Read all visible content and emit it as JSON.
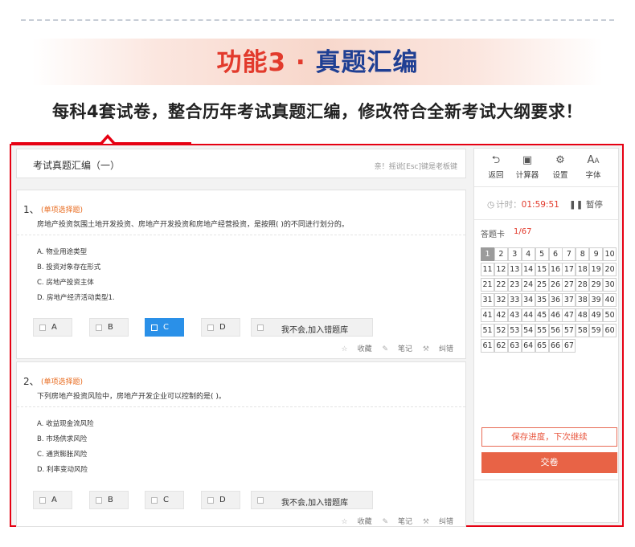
{
  "banner": {
    "title_accent": "功能3 · ",
    "title_main": "真题汇编",
    "subtitle": "每科4套试卷，整合历年考试真题汇编，修改符合全新考试大纲要求！"
  },
  "exam": {
    "title": "考试真题汇编（一）",
    "hint": "亲！摇说[Esc]键是老板键"
  },
  "questions": [
    {
      "number": "1、",
      "type": "(单项选择题)",
      "text": "房地产投资氛围土地开发投资、房地产开发投资和房地产经营投资，是按照( )的不同进行划分的。",
      "options": [
        "A. 物业用途类型",
        "B. 投资对象存在形式",
        "C. 房地产投资主体",
        "D. 房地产经济活动类型1."
      ],
      "answers": [
        "A",
        "B",
        "C",
        "D"
      ],
      "selected_answer": "C",
      "unsure_label": "我不会,加入错题库"
    },
    {
      "number": "2、",
      "type": "(单项选择题)",
      "text": "下列房地产投资风险中，房地产开发企业可以控制的是( )。",
      "options": [
        "A. 收益现金流风险",
        "B. 市场供求风险",
        "C. 通货膨胀风险",
        "D. 利率变动风险"
      ],
      "answers": [
        "A",
        "B",
        "C",
        "D"
      ],
      "selected_answer": "",
      "unsure_label": "我不会,加入错题库"
    }
  ],
  "question_tools": {
    "favorite": "收藏",
    "notes": "笔记",
    "correct": "纠错"
  },
  "toolbar": [
    {
      "label": "返回",
      "icon": "back-arrow-icon"
    },
    {
      "label": "计算器",
      "icon": "calculator-icon"
    },
    {
      "label": "设置",
      "icon": "gear-icon"
    },
    {
      "label": "字体",
      "icon": "font-size-icon"
    }
  ],
  "timer": {
    "label": "计时：",
    "value": "01:59:51",
    "pause_label": "暂停"
  },
  "answer_sheet": {
    "label": "答题卡",
    "progress": "1/67",
    "current": 1,
    "total": 67
  },
  "buttons": {
    "save": "保存进度，下次继续",
    "submit": "交卷"
  },
  "colors": {
    "accent_red": "#e23a2c",
    "title_blue": "#1f3f93",
    "frame_red": "#e60012",
    "selected_blue": "#2a90e8",
    "submit_orange": "#e86346"
  }
}
